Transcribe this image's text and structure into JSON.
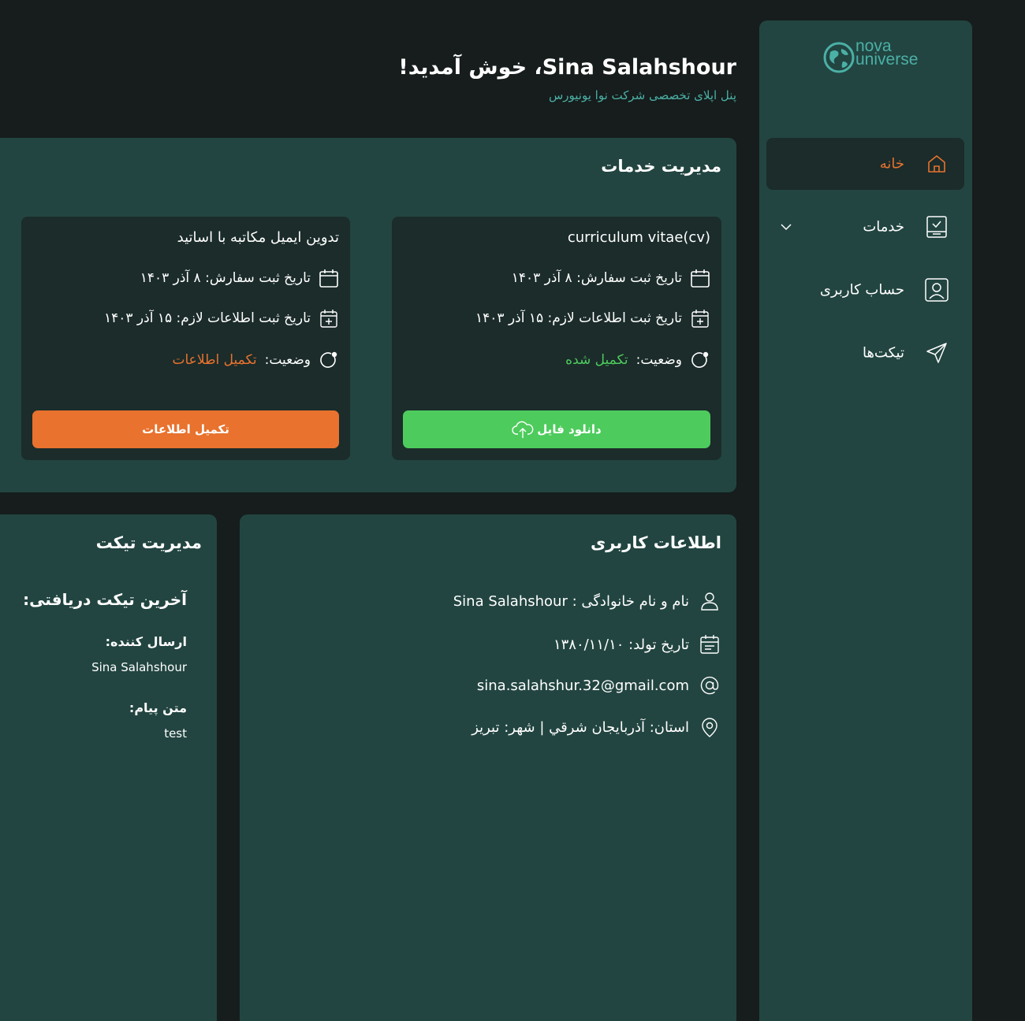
{
  "brand": {
    "line1": "nova",
    "line2": "universe"
  },
  "header": {
    "welcome": "Sina Salahshour، خوش آمدید!",
    "subtitle": "پنل اپلای تخصصی شرکت نوا یونیورس"
  },
  "nav": {
    "home": "خانه",
    "services": "خدمات",
    "account": "حساب کاربری",
    "tickets": "تیکت‌ها"
  },
  "services": {
    "title": "مدیریت خدمات",
    "cards": [
      {
        "title": "curriculum vitae(cv)",
        "order_date": "تاریخ ثبت سفارش: ۸ آذر ۱۴۰۳",
        "info_date": "تاریخ ثبت اطلاعات لازم: ۱۵ آذر ۱۴۰۳",
        "status_label": "وضعیت:",
        "status_value": "تکمیل شده",
        "button": "دانلود فایل"
      },
      {
        "title": "تدوین ایمیل مکاتبه با اساتید",
        "order_date": "تاریخ ثبت سفارش: ۸ آذر ۱۴۰۳",
        "info_date": "تاریخ ثبت اطلاعات لازم: ۱۵ آذر ۱۴۰۳",
        "status_label": "وضعیت:",
        "status_value": "تکمیل اطلاعات",
        "button": "تکمیل اطلاعات"
      }
    ]
  },
  "user_info": {
    "title": "اطلاعات کاربری",
    "name": "نام و نام خانوادگی : Sina Salahshour",
    "birth": "تاریخ تولد: ۱۳۸۰/۱۱/۱۰",
    "email": "sina.salahshur.32@gmail.com",
    "location": "استان: آذربايجان شرقي | شهر: تبريز"
  },
  "tickets": {
    "title": "مدیریت تیکت",
    "heading": "آخرین تیکت دریافتی:",
    "sender_label": "ارسال کننده:",
    "sender_value": "Sina Salahshour",
    "message_label": "متن پیام:",
    "message_value": "test"
  },
  "colors": {
    "accent": "#e8722e",
    "success": "#4ecb5d",
    "teal": "#4bb0a6",
    "panel": "#224541",
    "card": "#1b2c2a",
    "background": "#161d1c"
  },
  "icons": [
    "globe-icon",
    "home-icon",
    "clipboard-icon",
    "user-icon",
    "send-icon",
    "calendar-icon",
    "calendar-plus-icon",
    "status-icon",
    "cloud-upload-icon",
    "at-icon",
    "location-icon"
  ]
}
